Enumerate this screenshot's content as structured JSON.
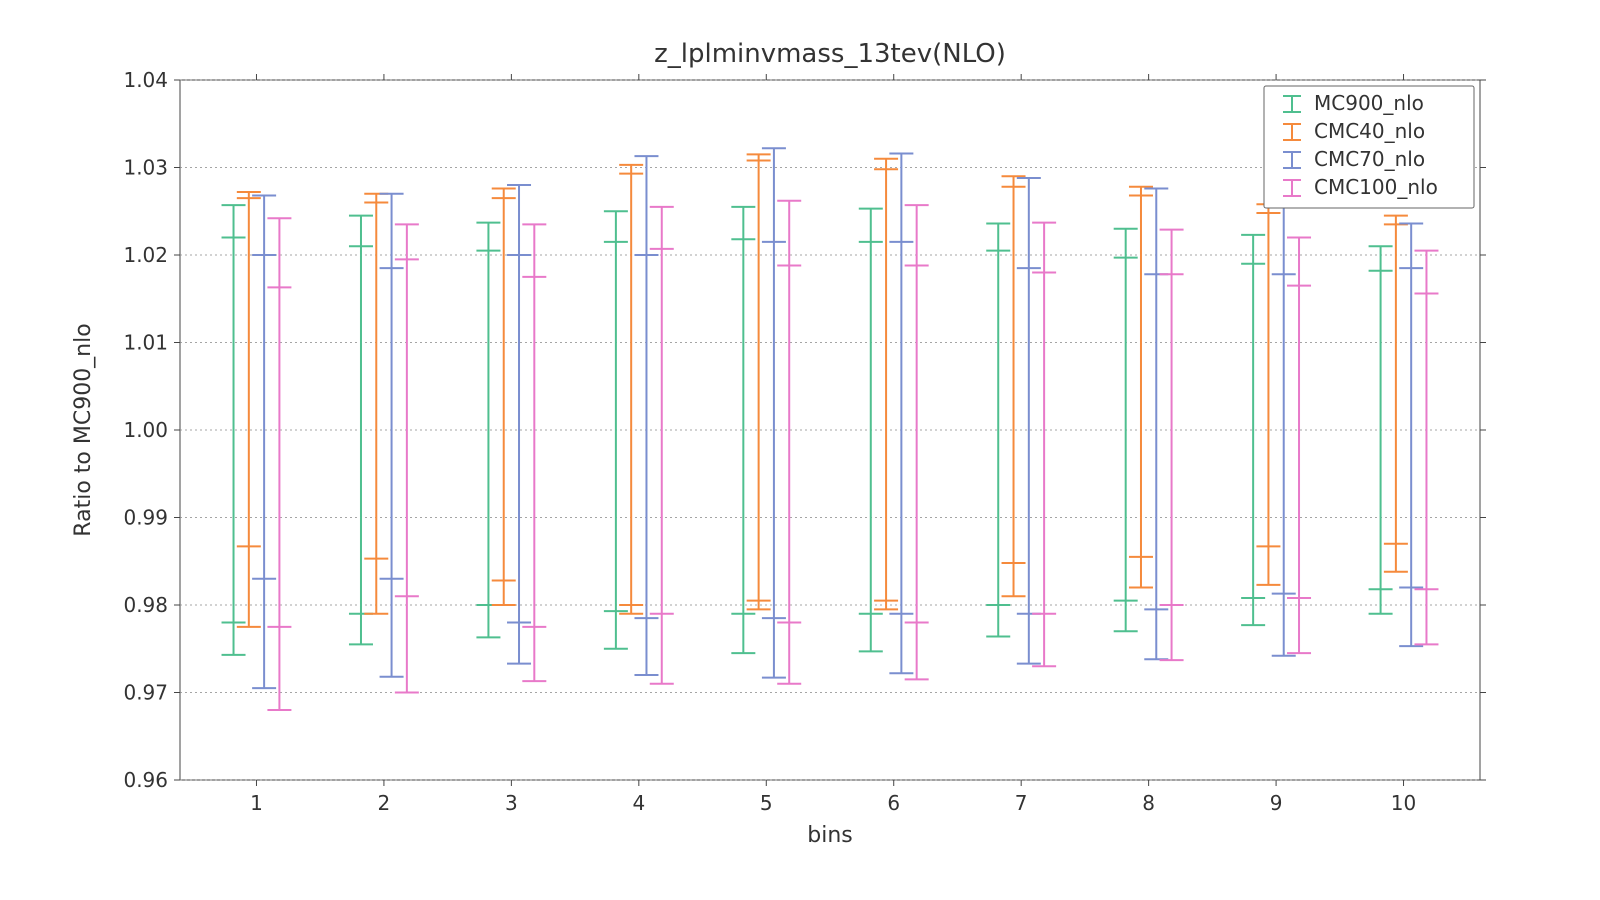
{
  "chart_data": {
    "type": "errorbar",
    "title": "z_lplminvmass_13tev(NLO)",
    "xlabel": "bins",
    "ylabel": "Ratio to MC900_nlo",
    "xlim": [
      0.4,
      10.6
    ],
    "ylim": [
      0.96,
      1.04
    ],
    "yticks": [
      0.96,
      0.97,
      0.98,
      0.99,
      1.0,
      1.01,
      1.02,
      1.03,
      1.04
    ],
    "ytick_labels": [
      "0.96",
      "0.97",
      "0.98",
      "0.99",
      "1.00",
      "1.01",
      "1.02",
      "1.03",
      "1.04"
    ],
    "xticks": [
      1,
      2,
      3,
      4,
      5,
      6,
      7,
      8,
      9,
      10
    ],
    "legend_position": "upper right",
    "colors": {
      "MC900_nlo": "#4fbf8f",
      "CMC40_nlo": "#f58a3c",
      "CMC70_nlo": "#7a8ecf",
      "CMC100_nlo": "#e879c9"
    },
    "series": [
      {
        "name": "MC900_nlo",
        "x_offset": -0.18,
        "points": [
          {
            "bin": 1,
            "outer_lo": 0.9743,
            "inner_lo": 0.978,
            "center": 1.0,
            "inner_hi": 1.022,
            "outer_hi": 1.0257
          },
          {
            "bin": 2,
            "outer_lo": 0.9755,
            "inner_lo": 0.979,
            "center": 1.0,
            "inner_hi": 1.021,
            "outer_hi": 1.0245
          },
          {
            "bin": 3,
            "outer_lo": 0.9763,
            "inner_lo": 0.98,
            "center": 1.0,
            "inner_hi": 1.0205,
            "outer_hi": 1.0237
          },
          {
            "bin": 4,
            "outer_lo": 0.975,
            "inner_lo": 0.9793,
            "center": 1.0,
            "inner_hi": 1.0215,
            "outer_hi": 1.025
          },
          {
            "bin": 5,
            "outer_lo": 0.9745,
            "inner_lo": 0.979,
            "center": 1.0,
            "inner_hi": 1.0218,
            "outer_hi": 1.0255
          },
          {
            "bin": 6,
            "outer_lo": 0.9747,
            "inner_lo": 0.979,
            "center": 1.0,
            "inner_hi": 1.0215,
            "outer_hi": 1.0253
          },
          {
            "bin": 7,
            "outer_lo": 0.9764,
            "inner_lo": 0.98,
            "center": 1.0,
            "inner_hi": 1.0205,
            "outer_hi": 1.0236
          },
          {
            "bin": 8,
            "outer_lo": 0.977,
            "inner_lo": 0.9805,
            "center": 1.0,
            "inner_hi": 1.0197,
            "outer_hi": 1.023
          },
          {
            "bin": 9,
            "outer_lo": 0.9777,
            "inner_lo": 0.9808,
            "center": 1.0,
            "inner_hi": 1.019,
            "outer_hi": 1.0223
          },
          {
            "bin": 10,
            "outer_lo": 0.979,
            "inner_lo": 0.9818,
            "center": 1.0,
            "inner_hi": 1.0182,
            "outer_hi": 1.021
          }
        ]
      },
      {
        "name": "CMC40_nlo",
        "x_offset": -0.06,
        "points": [
          {
            "bin": 1,
            "outer_lo": 0.9775,
            "inner_lo": 0.9867,
            "center": 1.0,
            "inner_hi": 1.0265,
            "outer_hi": 1.0272
          },
          {
            "bin": 2,
            "outer_lo": 0.979,
            "inner_lo": 0.9853,
            "center": 1.0,
            "inner_hi": 1.026,
            "outer_hi": 1.027
          },
          {
            "bin": 3,
            "outer_lo": 0.98,
            "inner_lo": 0.9828,
            "center": 1.0,
            "inner_hi": 1.0265,
            "outer_hi": 1.0276
          },
          {
            "bin": 4,
            "outer_lo": 0.979,
            "inner_lo": 0.98,
            "center": 1.0,
            "inner_hi": 1.0293,
            "outer_hi": 1.0303
          },
          {
            "bin": 5,
            "outer_lo": 0.9795,
            "inner_lo": 0.9805,
            "center": 1.0,
            "inner_hi": 1.0308,
            "outer_hi": 1.0315
          },
          {
            "bin": 6,
            "outer_lo": 0.9795,
            "inner_lo": 0.9805,
            "center": 1.0,
            "inner_hi": 1.0298,
            "outer_hi": 1.031
          },
          {
            "bin": 7,
            "outer_lo": 0.981,
            "inner_lo": 0.9848,
            "center": 1.0,
            "inner_hi": 1.0278,
            "outer_hi": 1.029
          },
          {
            "bin": 8,
            "outer_lo": 0.982,
            "inner_lo": 0.9855,
            "center": 1.0,
            "inner_hi": 1.0268,
            "outer_hi": 1.0278
          },
          {
            "bin": 9,
            "outer_lo": 0.9823,
            "inner_lo": 0.9867,
            "center": 1.0,
            "inner_hi": 1.0248,
            "outer_hi": 1.0258
          },
          {
            "bin": 10,
            "outer_lo": 0.9838,
            "inner_lo": 0.987,
            "center": 1.0,
            "inner_hi": 1.0235,
            "outer_hi": 1.0245
          }
        ]
      },
      {
        "name": "CMC70_nlo",
        "x_offset": 0.06,
        "points": [
          {
            "bin": 1,
            "outer_lo": 0.9705,
            "inner_lo": 0.983,
            "center": 1.0,
            "inner_hi": 1.02,
            "outer_hi": 1.0268
          },
          {
            "bin": 2,
            "outer_lo": 0.9718,
            "inner_lo": 0.983,
            "center": 1.0,
            "inner_hi": 1.0185,
            "outer_hi": 1.027
          },
          {
            "bin": 3,
            "outer_lo": 0.9733,
            "inner_lo": 0.978,
            "center": 1.0,
            "inner_hi": 1.02,
            "outer_hi": 1.028
          },
          {
            "bin": 4,
            "outer_lo": 0.972,
            "inner_lo": 0.9785,
            "center": 1.0,
            "inner_hi": 1.02,
            "outer_hi": 1.0313
          },
          {
            "bin": 5,
            "outer_lo": 0.9717,
            "inner_lo": 0.9785,
            "center": 1.0,
            "inner_hi": 1.0215,
            "outer_hi": 1.0322
          },
          {
            "bin": 6,
            "outer_lo": 0.9722,
            "inner_lo": 0.979,
            "center": 1.0,
            "inner_hi": 1.0215,
            "outer_hi": 1.0316
          },
          {
            "bin": 7,
            "outer_lo": 0.9733,
            "inner_lo": 0.979,
            "center": 1.0,
            "inner_hi": 1.0185,
            "outer_hi": 1.0288
          },
          {
            "bin": 8,
            "outer_lo": 0.9738,
            "inner_lo": 0.9795,
            "center": 1.0,
            "inner_hi": 1.0178,
            "outer_hi": 1.0276
          },
          {
            "bin": 9,
            "outer_lo": 0.9742,
            "inner_lo": 0.9813,
            "center": 1.0,
            "inner_hi": 1.0178,
            "outer_hi": 1.0256
          },
          {
            "bin": 10,
            "outer_lo": 0.9753,
            "inner_lo": 0.982,
            "center": 1.0,
            "inner_hi": 1.0185,
            "outer_hi": 1.0236
          }
        ]
      },
      {
        "name": "CMC100_nlo",
        "x_offset": 0.18,
        "points": [
          {
            "bin": 1,
            "outer_lo": 0.968,
            "inner_lo": 0.9775,
            "center": 1.0,
            "inner_hi": 1.0163,
            "outer_hi": 1.0242
          },
          {
            "bin": 2,
            "outer_lo": 0.97,
            "inner_lo": 0.981,
            "center": 1.0,
            "inner_hi": 1.0195,
            "outer_hi": 1.0235
          },
          {
            "bin": 3,
            "outer_lo": 0.9713,
            "inner_lo": 0.9775,
            "center": 1.0,
            "inner_hi": 1.0175,
            "outer_hi": 1.0235
          },
          {
            "bin": 4,
            "outer_lo": 0.971,
            "inner_lo": 0.979,
            "center": 1.0,
            "inner_hi": 1.0207,
            "outer_hi": 1.0255
          },
          {
            "bin": 5,
            "outer_lo": 0.971,
            "inner_lo": 0.978,
            "center": 1.0,
            "inner_hi": 1.0188,
            "outer_hi": 1.0262
          },
          {
            "bin": 6,
            "outer_lo": 0.9715,
            "inner_lo": 0.978,
            "center": 1.0,
            "inner_hi": 1.0188,
            "outer_hi": 1.0257
          },
          {
            "bin": 7,
            "outer_lo": 0.973,
            "inner_lo": 0.979,
            "center": 1.0,
            "inner_hi": 1.018,
            "outer_hi": 1.0237
          },
          {
            "bin": 8,
            "outer_lo": 0.9737,
            "inner_lo": 0.98,
            "center": 1.0,
            "inner_hi": 1.0178,
            "outer_hi": 1.0229
          },
          {
            "bin": 9,
            "outer_lo": 0.9745,
            "inner_lo": 0.9808,
            "center": 1.0,
            "inner_hi": 1.0165,
            "outer_hi": 1.022
          },
          {
            "bin": 10,
            "outer_lo": 0.9755,
            "inner_lo": 0.9818,
            "center": 1.0,
            "inner_hi": 1.0156,
            "outer_hi": 1.0205
          }
        ]
      }
    ]
  }
}
